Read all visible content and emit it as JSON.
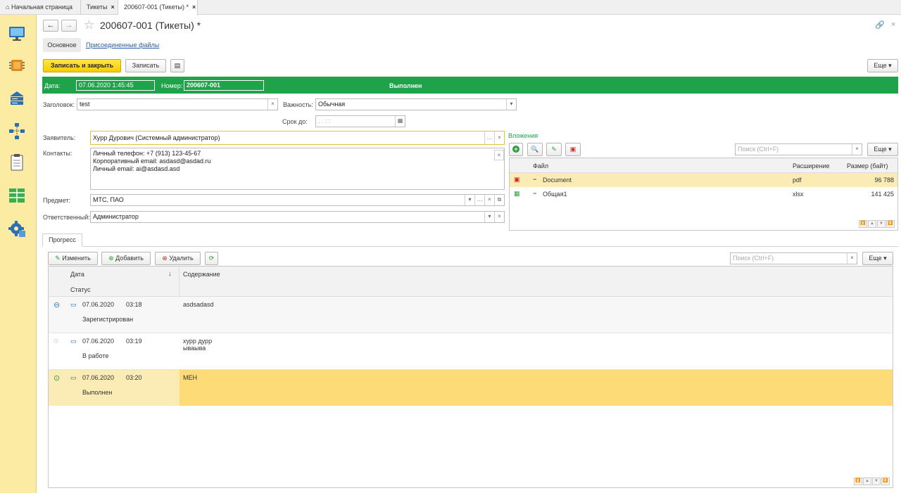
{
  "tabs": [
    {
      "label": "Начальная страница",
      "closable": false
    },
    {
      "label": "Тикеты",
      "closable": true
    },
    {
      "label": "200607-001 (Тикеты) *",
      "closable": true,
      "active": true
    }
  ],
  "header": {
    "title": "200607-001 (Тикеты) *"
  },
  "subtabs": {
    "main": "Основное",
    "attached": "Присоединенные файлы"
  },
  "toolbar": {
    "save_close": "Записать и закрыть",
    "save": "Записать",
    "more": "Еще"
  },
  "status_bar": {
    "date_label": "Дата:",
    "date_value": "07.06.2020  1:45:45",
    "number_label": "Номер:",
    "number_value": "200607-001",
    "status": "Выполнен",
    "color": "#1ea34a"
  },
  "form": {
    "title_label": "Заголовок:",
    "title_value": "test",
    "importance_label": "Важность:",
    "importance_value": "Обычная",
    "deadline_label": "Срок до:",
    "deadline_value": " .  .       :  :",
    "applicant_label": "Заявитель:",
    "applicant_value": "Хурр Дурович (Системный администратор)",
    "contacts_label": "Контакты:",
    "contacts_lines": [
      "Личный телефон: +7 (913) 123-45-67",
      "Корпоративный email: asdasd@asdad.ru",
      "Личный email: ai@asdasd.asd"
    ],
    "subject_label": "Предмет:",
    "subject_value": "МТС, ПАО",
    "responsible_label": "Ответственный:",
    "responsible_value": "Администратор"
  },
  "attachments": {
    "title": "Вложения",
    "search_placeholder": "Поиск (Ctrl+F)",
    "more": "Еще",
    "columns": [
      "Файл",
      "Расширение",
      "Размер (байт)"
    ],
    "rows": [
      {
        "name": "Document",
        "ext": "pdf",
        "size": "96 788",
        "icon": "pdf-icon"
      },
      {
        "name": "Общая1",
        "ext": "xlsx",
        "size": "141 425",
        "icon": "excel-icon"
      }
    ]
  },
  "progress": {
    "tab": "Прогресс",
    "edit": "Изменить",
    "add": "Добавить",
    "delete": "Удалить",
    "search_placeholder": "Поиск (Ctrl+F)",
    "more": "Еще",
    "col_date": "Дата",
    "col_sort": "↓",
    "col_status": "Статус",
    "col_content": "Содержание",
    "rows": [
      {
        "date": "07.06.2020",
        "time": "03:18",
        "status": "Зарегистрирован",
        "content": [
          "asdsadasd"
        ],
        "icon": "registered-icon"
      },
      {
        "date": "07.06.2020",
        "time": "03:19",
        "status": "В работе",
        "content": [
          "хурр дурр",
          "ываыва"
        ],
        "icon": "in-progress-icon"
      },
      {
        "date": "07.06.2020",
        "time": "03:20",
        "status": "Выполнен",
        "content": [
          "МЕН"
        ],
        "icon": "done-icon"
      }
    ]
  }
}
